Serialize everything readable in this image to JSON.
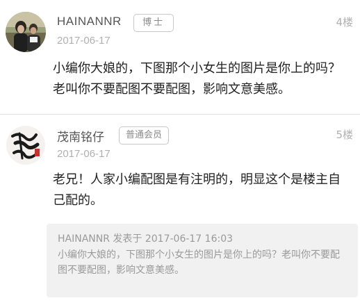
{
  "posts": [
    {
      "username": "HAINANNR",
      "rank": "博士",
      "date": "2017-06-17",
      "floor": "4楼",
      "content": "小编你大娘的，下图那个小女生的图片是你上的吗？老叫你不要配图不要配图，影响文意美感。"
    },
    {
      "username": "茂南铭仔",
      "rank": "普通会员",
      "date": "2017-06-17",
      "floor": "5楼",
      "content": "老兄！人家小编配图是有注明的，明显这个是楼主自己配的。",
      "quote": {
        "header": "HAINANNR 发表于 2017-06-17 16:03",
        "text": "小编你大娘的，下图那个小女生的图片是你上的吗？老叫你不要配图不要配图，影响文意美感。"
      }
    }
  ],
  "colors": {
    "text_primary": "#222222",
    "text_muted": "#b0b0b0",
    "quote_bg": "#f1f1f1",
    "divider": "#e4e4e4"
  },
  "icons": {
    "avatar_1": "avatar-photo",
    "avatar_2": "avatar-calligraphy"
  }
}
